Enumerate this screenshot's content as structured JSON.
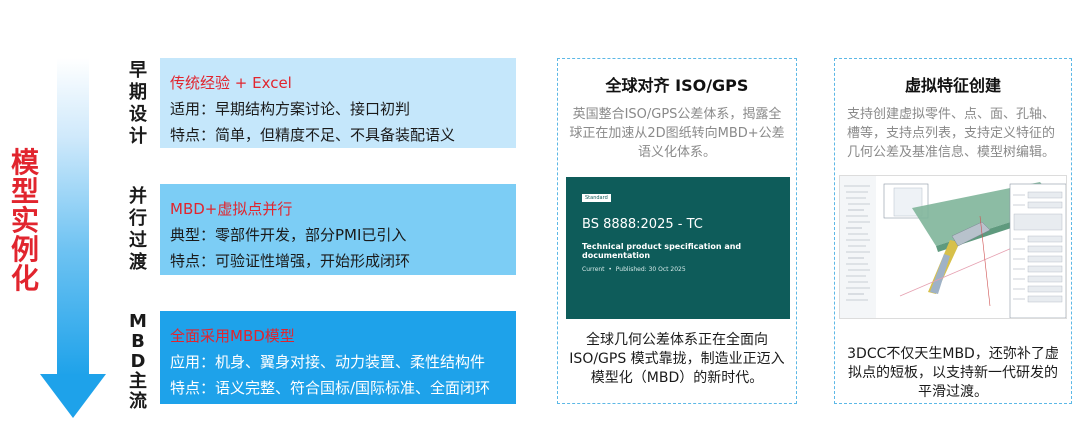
{
  "side_title": [
    "模",
    "型",
    "实",
    "例",
    "化"
  ],
  "stages": [
    {
      "label": [
        "早",
        "期",
        "设",
        "计"
      ],
      "title": "传统经验 + Excel",
      "line1": "适用：早期结构方案讨论、接口初判",
      "line2": "特点：简单，但精度不足、不具备装配语义"
    },
    {
      "label": [
        "并",
        "行",
        "过",
        "渡"
      ],
      "title": "MBD+虚拟点并行",
      "line1": "典型：零部件开发，部分PMI已引入",
      "line2": "特点：可验证性增强，开始形成闭环"
    },
    {
      "label": [
        "M",
        "B",
        "D",
        "主",
        "流"
      ],
      "title": "全面采用MBD模型",
      "line1": "应用：机身、翼身对接、动力装置、柔性结构件",
      "line2": "特点：语义完整、符合国标/国际标准、全面闭环"
    }
  ],
  "panel_iso": {
    "title": "全球对齐 ISO/GPS",
    "desc": "英国整合ISO/GPS公差体系，揭露全球正在加速从2D图纸转向MBD+公差语义化体系。",
    "standard": {
      "badge": "Standard",
      "code": "BS 8888:2025 - TC",
      "name": "Technical product specification and documentation",
      "status": "Current",
      "published": "Published: 30 Oct 2025"
    },
    "foot": "全球几何公差体系正在全面向ISO/GPS 模式靠拢，制造业正迈入模型化（MBD）的新时代。"
  },
  "panel_vf": {
    "title": "虚拟特征创建",
    "desc": "支持创建虚拟零件、点、面、孔轴、槽等，支持点列表，支持定义特征的几何公差及基准信息、模型树编辑。",
    "foot": "3DCC不仅天生MBD，还弥补了虚拟点的短板，以支持新一代研发的平滑过渡。"
  }
}
